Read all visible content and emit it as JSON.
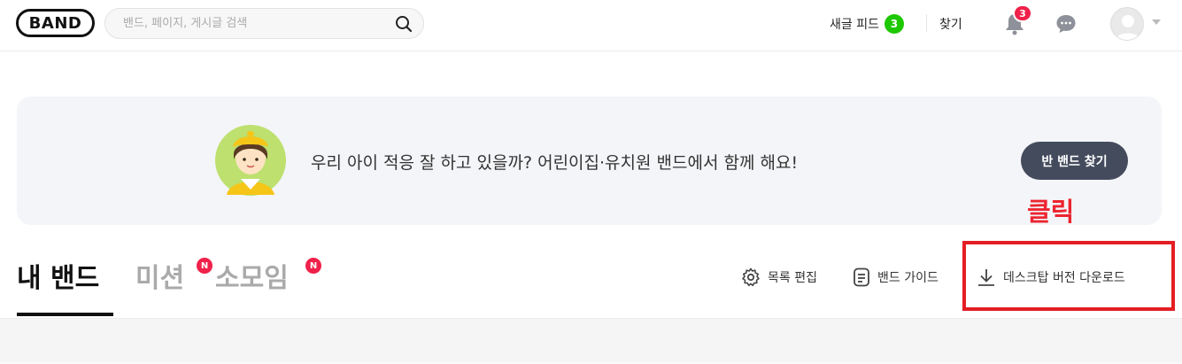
{
  "header": {
    "logo": "BAND",
    "search_placeholder": "밴드, 페이지, 게시글 검색",
    "feed_label": "새글 피드",
    "feed_count": "3",
    "find_label": "찾기",
    "notification_count": "3"
  },
  "banner": {
    "message": "우리 아이 적응 잘 하고 있을까? 어린이집·유치원 밴드에서 함께 해요!",
    "button_label": "반 밴드 찾기"
  },
  "annotation": {
    "label": "클릭"
  },
  "tabs": [
    {
      "label": "내 밴드",
      "new_badge": ""
    },
    {
      "label": "미션",
      "new_badge": "N"
    },
    {
      "label": "소모임",
      "new_badge": "N"
    }
  ],
  "tools": {
    "edit_list": "목록 편집",
    "band_guide": "밴드 가이드",
    "desktop_download": "데스크탑 버전 다운로드"
  },
  "colors": {
    "green": "#1ec800",
    "red_badge": "#f0214a",
    "annotation_red": "#e41e25",
    "banner_bg": "#f4f5f8",
    "button_dark": "#444b5d"
  }
}
